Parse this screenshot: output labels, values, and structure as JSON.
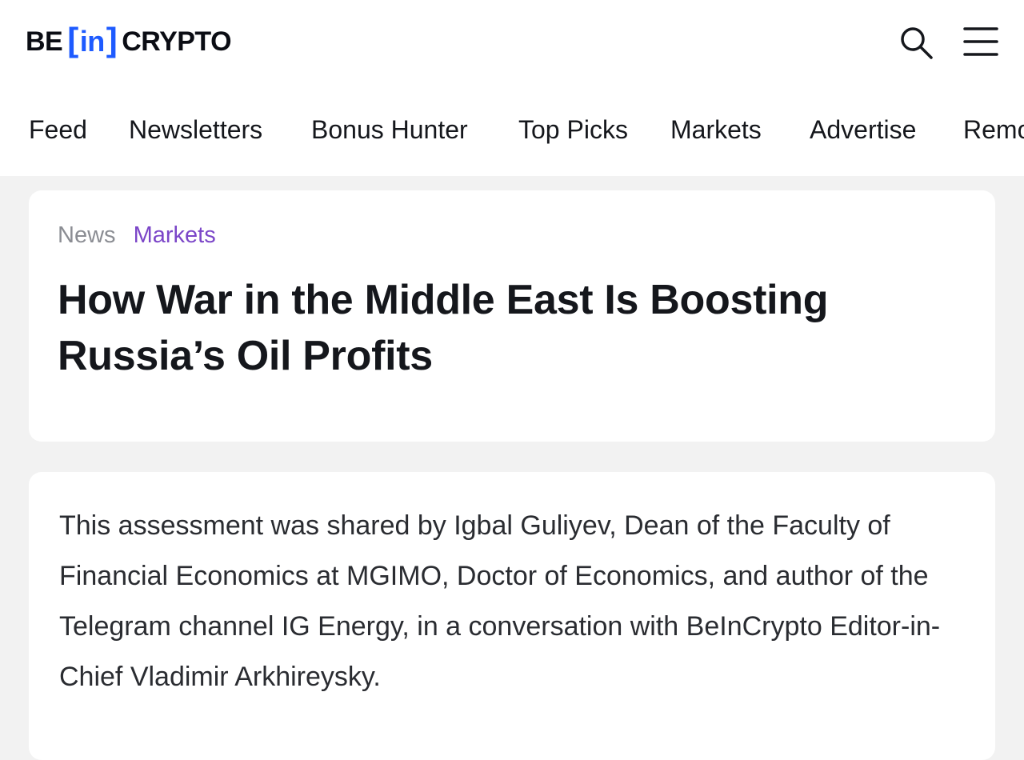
{
  "logo": {
    "be": "BE",
    "bracket_open": "[",
    "in": "in",
    "bracket_close": "]",
    "crypto": "CRYPTO",
    "accent_color": "#1e5bff"
  },
  "header": {
    "search_icon": "search-icon",
    "menu_icon": "hamburger-menu-icon"
  },
  "nav": {
    "items": [
      {
        "label": "Feed"
      },
      {
        "label": "Newsletters"
      },
      {
        "label": "Bonus Hunter"
      },
      {
        "label": "Top Picks"
      },
      {
        "label": "Markets"
      },
      {
        "label": "Advertise"
      },
      {
        "label": "Remo"
      }
    ]
  },
  "article": {
    "breadcrumb": {
      "news": "News",
      "markets": "Markets",
      "markets_color": "#7b46c8"
    },
    "title": "How War in the Middle East Is Boosting Russia’s Oil Profits",
    "lead": "This assessment was shared by Igbal Guliyev, Dean of the Faculty of Financial Economics at MGIMO, Doctor of Economics, and author of the Telegram channel IG Energy, in a conversation with BeInCrypto Editor-in-Chief Vladimir Arkhireysky."
  }
}
